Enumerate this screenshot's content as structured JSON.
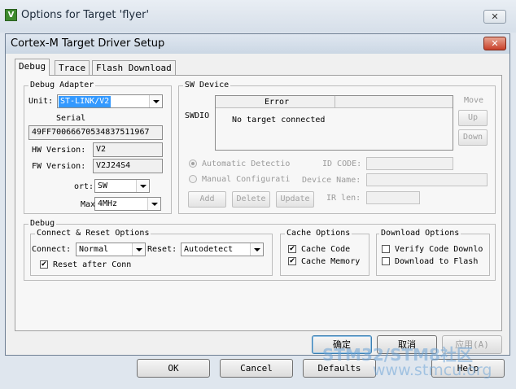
{
  "outer_window": {
    "title": "Options for Target 'flyer'",
    "icon_letter": "V",
    "close_glyph": "✕",
    "buttons": {
      "ok": "OK",
      "cancel": "Cancel",
      "defaults": "Defaults",
      "help": "Help"
    }
  },
  "dialog": {
    "title": "Cortex-M Target Driver Setup",
    "close_glyph": "✕",
    "tabs": [
      "Debug",
      "Trace",
      "Flash Download"
    ],
    "active_tab": "Debug",
    "debug_adapter": {
      "group_label": "Debug Adapter",
      "unit_label": "Unit:",
      "unit_value": "ST-LINK/V2",
      "serial_label": "Serial",
      "serial_value": "49FF70066670534837511967",
      "hw_label": "HW Version:",
      "hw_value": "V2",
      "fw_label": "FW Version:",
      "fw_value": "V2J24S4",
      "port_label": "ort:",
      "port_value": "SW",
      "max_label": "Max",
      "max_value": "4MHz"
    },
    "sw_device": {
      "group_label": "SW Device",
      "swdio_label": "SWDIO",
      "column_error": "Error",
      "row_text": "No target connected",
      "move_label": "Move",
      "up_button": "Up",
      "down_button": "Down",
      "auto_detect": "Automatic Detectio",
      "manual_config": "Manual Configurati",
      "id_code_label": "ID CODE:",
      "device_name_label": "Device Name:",
      "ir_len_label": "IR len:",
      "add_button": "Add",
      "delete_button": "Delete",
      "update_button": "Update"
    },
    "debug": {
      "group_label": "Debug",
      "connect_reset": {
        "group_label": "Connect & Reset Options",
        "connect_label": "Connect:",
        "connect_value": "Normal",
        "reset_label": "Reset:",
        "reset_value": "Autodetect",
        "reset_after_conn": "Reset after Conn",
        "reset_after_conn_checked": true
      },
      "cache_options": {
        "group_label": "Cache Options",
        "cache_code": "Cache Code",
        "cache_code_checked": true,
        "cache_memory": "Cache Memory",
        "cache_memory_checked": true
      },
      "download_options": {
        "group_label": "Download Options",
        "verify_code": "Verify Code Downlo",
        "verify_code_checked": false,
        "download_to_flash": "Download to Flash",
        "download_to_flash_checked": false
      }
    },
    "buttons": {
      "ok": "确定",
      "cancel": "取消",
      "apply": "应用(A)"
    }
  },
  "watermark": {
    "line1": "STM32/STM8社区",
    "line2": "www.stmcu.org"
  },
  "colors": {
    "accent_selection": "#3399ff",
    "close_red": "#c8402a",
    "watermark": "#6fa6d8"
  }
}
